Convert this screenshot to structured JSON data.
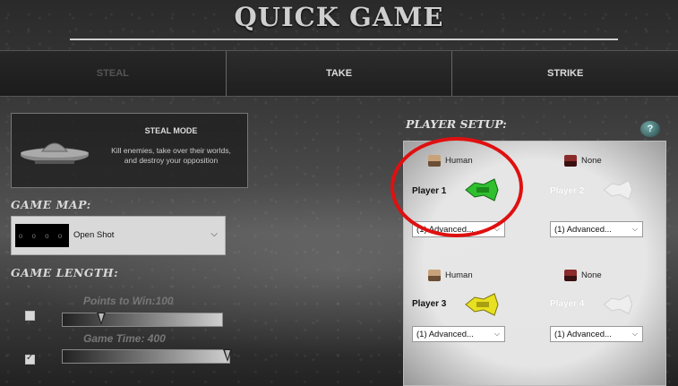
{
  "title": "QUICK GAME",
  "tabs": [
    {
      "label": "STEAL",
      "active": true
    },
    {
      "label": "TAKE",
      "active": false
    },
    {
      "label": "STRIKE",
      "active": false
    }
  ],
  "mode": {
    "title": "STEAL MODE",
    "description": "Kill enemies, take over their worlds, and destroy your opposition"
  },
  "game_map": {
    "label": "GAME MAP:",
    "thumbnail_text": "o o o o",
    "selected": "Open Shot"
  },
  "game_length": {
    "label": "GAME LENGTH:",
    "points": {
      "label": "Points to Win:100",
      "checked": false,
      "fraction": 0.28
    },
    "time": {
      "label": "Game Time: 400",
      "checked": true,
      "fraction": 1.0
    }
  },
  "player_setup": {
    "label": "PLAYER SETUP:",
    "help_icon": "help-icon",
    "players": [
      {
        "name": "Player 1",
        "type": "Human",
        "ai": "(1) Advanced...",
        "color": "#2fbf2f",
        "active": true
      },
      {
        "name": "Player 2",
        "type": "None",
        "ai": "(1) Advanced...",
        "color": "#e0e0e0",
        "active": false
      },
      {
        "name": "Player 3",
        "type": "Human",
        "ai": "(1) Advanced...",
        "color": "#e8e020",
        "active": true
      },
      {
        "name": "Player 4",
        "type": "None",
        "ai": "(1) Advanced...",
        "color": "#e0e0e0",
        "active": false
      }
    ]
  },
  "annotation_color": "#e01010"
}
